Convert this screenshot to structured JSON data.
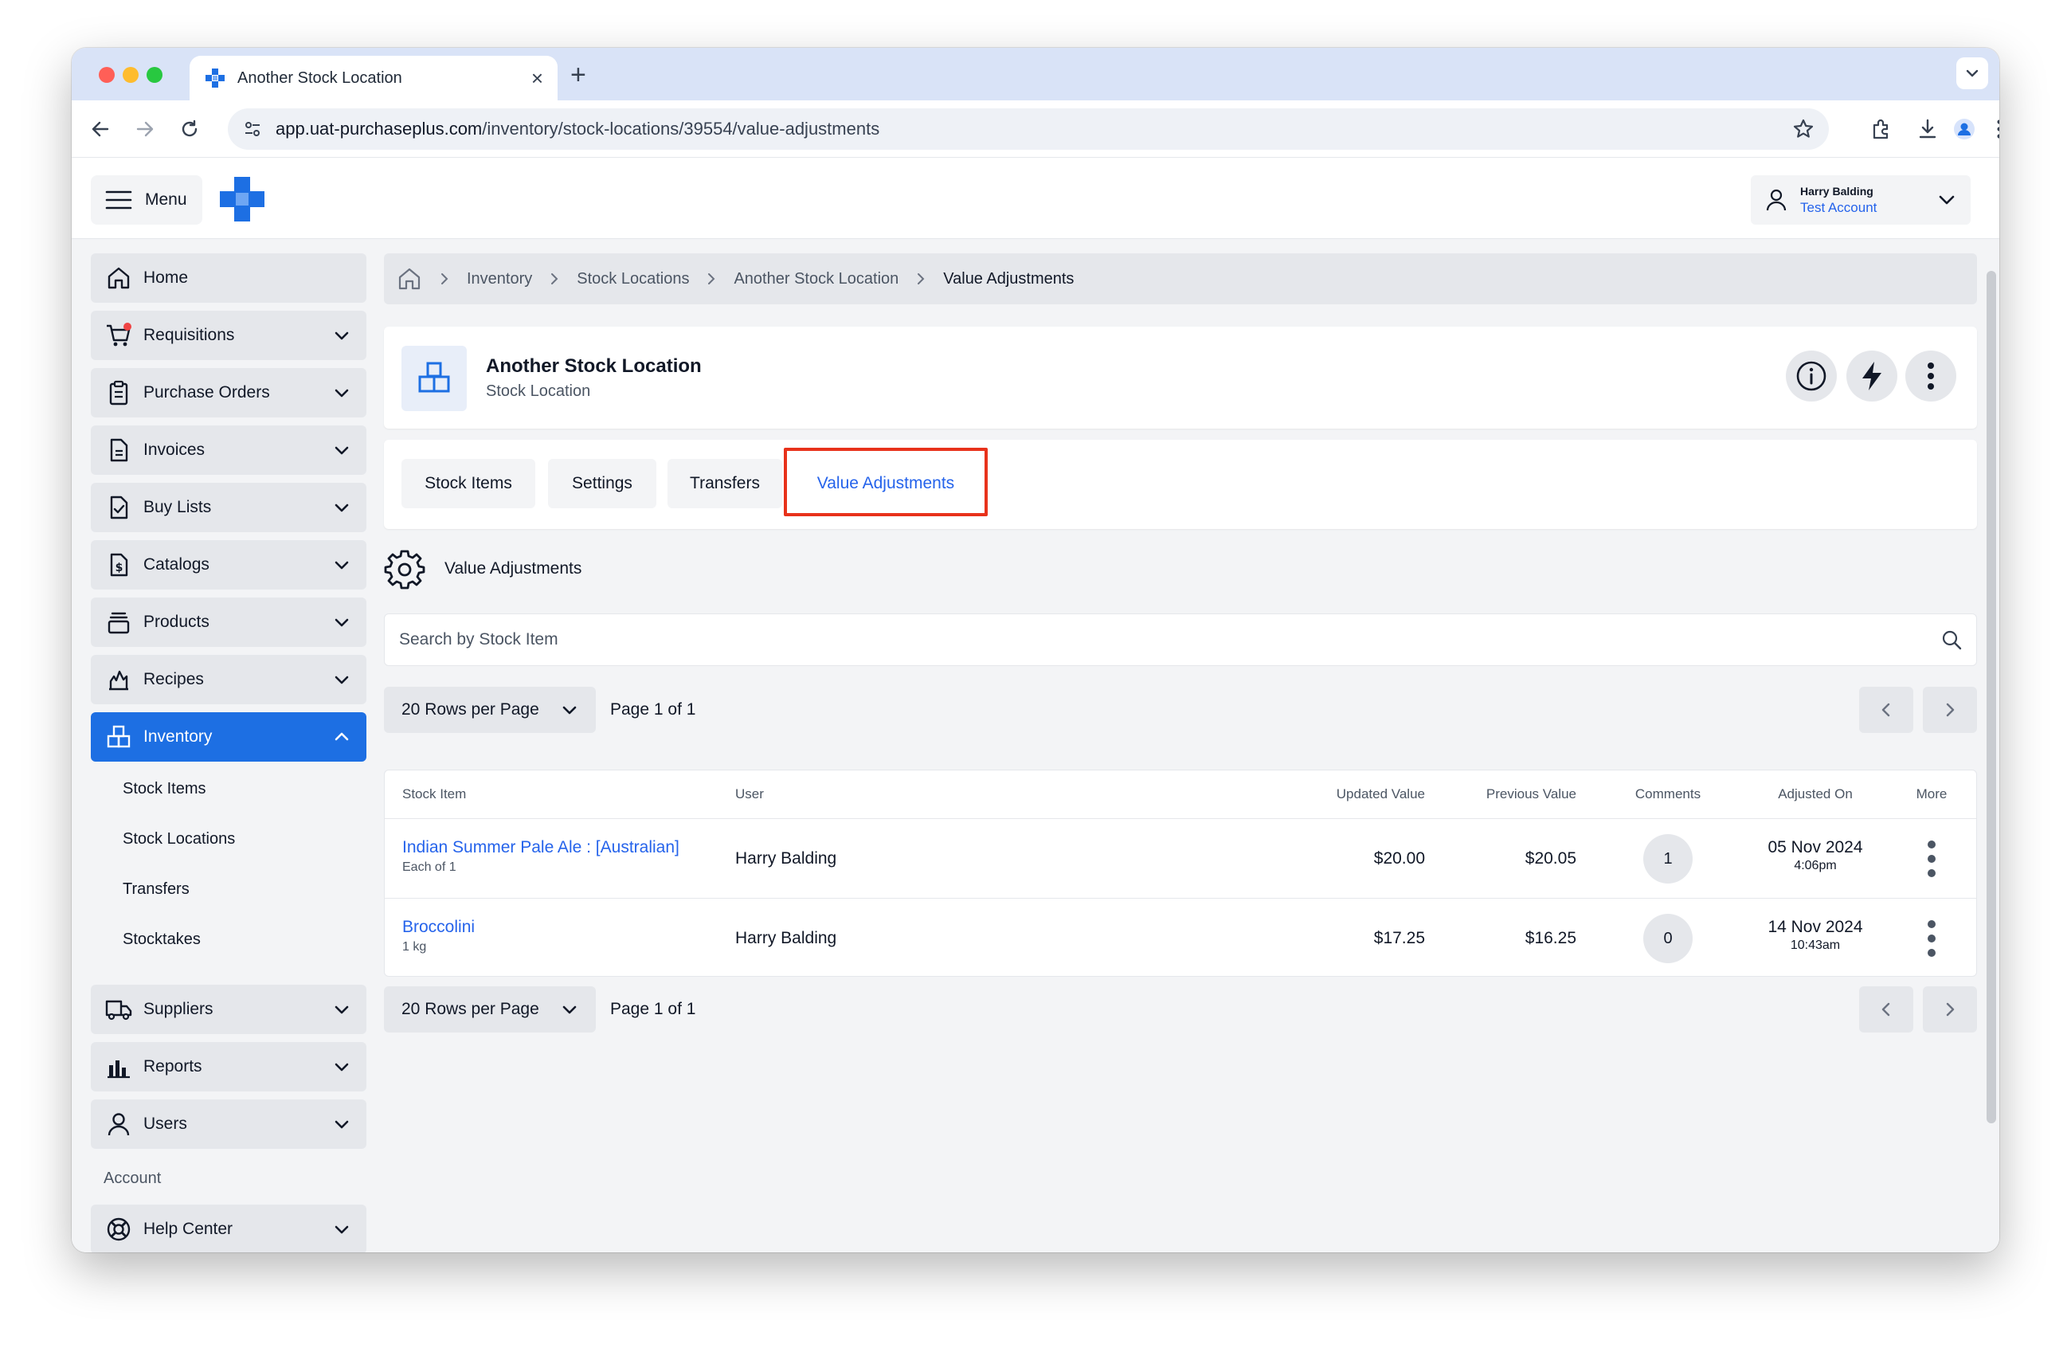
{
  "browser": {
    "tab_title": "Another Stock Location",
    "new_tab": "+",
    "close": "×",
    "url_domain": "app.uat-purchaseplus.com",
    "url_path": "/inventory/stock-locations/39554/value-adjustments"
  },
  "header": {
    "menu_label": "Menu",
    "user_name": "Harry Balding",
    "account_name": "Test Account"
  },
  "sidebar": {
    "items": [
      {
        "label": "Home",
        "icon": "home-icon"
      },
      {
        "label": "Requisitions",
        "icon": "cart-icon"
      },
      {
        "label": "Purchase Orders",
        "icon": "clipboard-icon"
      },
      {
        "label": "Invoices",
        "icon": "document-icon"
      },
      {
        "label": "Buy Lists",
        "icon": "checklist-icon"
      },
      {
        "label": "Catalogs",
        "icon": "dollar-document-icon"
      },
      {
        "label": "Products",
        "icon": "stack-icon"
      },
      {
        "label": "Recipes",
        "icon": "flame-icon"
      },
      {
        "label": "Inventory",
        "icon": "boxes-icon"
      },
      {
        "label": "Suppliers",
        "icon": "truck-icon"
      },
      {
        "label": "Reports",
        "icon": "bar-chart-icon"
      },
      {
        "label": "Users",
        "icon": "user-icon"
      }
    ],
    "inventory_sub": [
      "Stock Items",
      "Stock Locations",
      "Transfers",
      "Stocktakes"
    ],
    "account_section": "Account",
    "help_center": "Help Center"
  },
  "breadcrumb": [
    "Inventory",
    "Stock Locations",
    "Another Stock Location",
    "Value Adjustments"
  ],
  "location": {
    "title": "Another Stock Location",
    "subtitle": "Stock Location"
  },
  "tabs": [
    "Stock Items",
    "Settings",
    "Transfers",
    "Value Adjustments"
  ],
  "active_tab": "Value Adjustments",
  "section_title": "Value Adjustments",
  "search": {
    "placeholder": "Search by Stock Item"
  },
  "pagination": {
    "rows_per_page": "20 Rows per Page",
    "page_label": "Page 1 of 1"
  },
  "table": {
    "headers": [
      "Stock Item",
      "User",
      "Updated Value",
      "Previous Value",
      "Comments",
      "Adjusted On",
      "More"
    ],
    "rows": [
      {
        "item": "Indian Summer Pale Ale : [Australian]",
        "unit": "Each of 1",
        "user": "Harry Balding",
        "updated": "$20.00",
        "previous": "$20.05",
        "comments": "1",
        "date": "05 Nov 2024",
        "time": "4:06pm"
      },
      {
        "item": "Broccolini",
        "unit": "1 kg",
        "user": "Harry Balding",
        "updated": "$17.25",
        "previous": "$16.25",
        "comments": "0",
        "date": "14 Nov 2024",
        "time": "10:43am"
      }
    ]
  },
  "colors": {
    "primary": "#1d6fe3",
    "link": "#2563eb",
    "highlight": "#e8321b"
  }
}
